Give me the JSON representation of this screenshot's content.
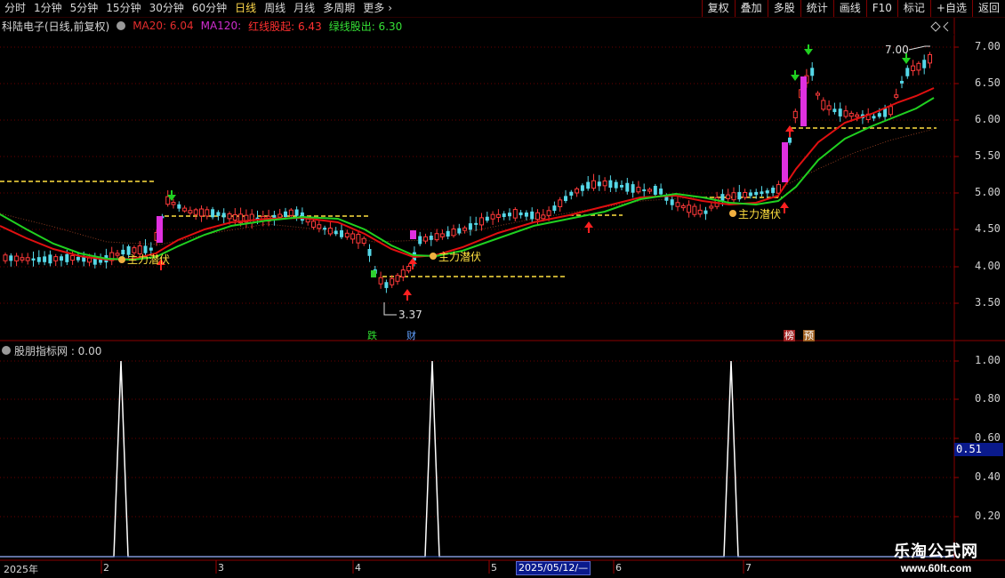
{
  "toolbar": {
    "periods": [
      {
        "label": "分时",
        "active": false
      },
      {
        "label": "1分钟",
        "active": false
      },
      {
        "label": "5分钟",
        "active": false
      },
      {
        "label": "15分钟",
        "active": false
      },
      {
        "label": "30分钟",
        "active": false
      },
      {
        "label": "60分钟",
        "active": false
      },
      {
        "label": "日线",
        "active": true
      },
      {
        "label": "周线",
        "active": false
      },
      {
        "label": "月线",
        "active": false
      },
      {
        "label": "多周期",
        "active": false
      },
      {
        "label": "更多",
        "active": false
      }
    ],
    "more_arrow": "›",
    "tools": [
      "复权",
      "叠加",
      "多股",
      "统计",
      "画线",
      "F10",
      "标记",
      "+自选",
      "返回"
    ]
  },
  "header": {
    "stock_title": "科陆电子(日线,前复权)",
    "ma20": "MA20: 6.04",
    "ma120": "MA120:",
    "red_signal": "红线股起: 6.43",
    "green_signal": "绿线股出: 6.30"
  },
  "indicator": {
    "title": "股朋指标网 : 0.00",
    "current_value": "0.51",
    "axis": [
      "1.00",
      "0.80",
      "0.60",
      "0.40",
      "0.20"
    ]
  },
  "price_axis": [
    "7.00",
    "6.50",
    "6.00",
    "5.50",
    "5.00",
    "4.50",
    "4.00",
    "3.50"
  ],
  "annotations": {
    "high_label": "7.00",
    "low_label": "3.37",
    "zhuli_1": "主力潜伏",
    "zhuli_2": "主力潜伏",
    "zhuli_3": "主力潜伏",
    "badge_die": "跌",
    "badge_cai": "财",
    "badge_bang": "榜",
    "badge_yu": "预"
  },
  "dates": {
    "year": "2025年",
    "m2": "2",
    "m3": "3",
    "m4": "4",
    "m5": "5",
    "cursor": "2025/05/12/—",
    "m6": "6",
    "m7": "7"
  },
  "colors": {
    "up": "#ff3a3a",
    "down": "#55d8e8",
    "ma_red": "#e01010",
    "ma_green": "#20d020",
    "dash": "#ffe040",
    "magenta": "#e030e0",
    "grid": "#7a0000"
  },
  "watermark": {
    "name": "乐淘公式网",
    "url": "www.60lt.com"
  }
}
